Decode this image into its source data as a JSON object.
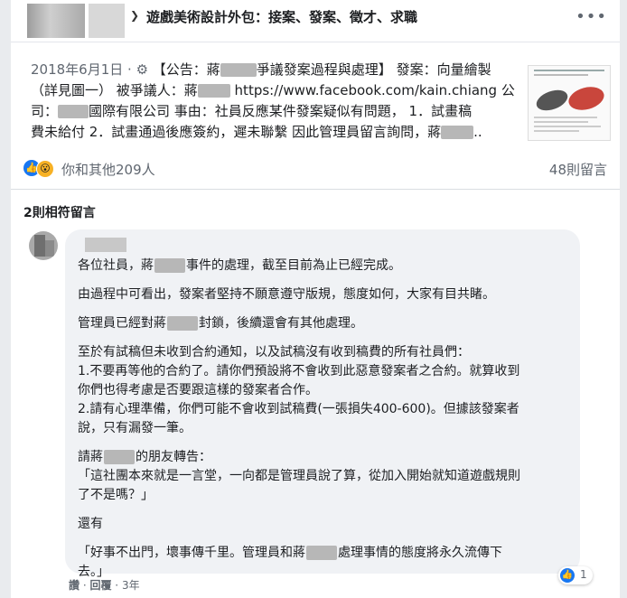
{
  "group": {
    "title": "遊戲美術設計外包：接案、發案、徵才、求職",
    "chevron": "❯",
    "more": "•••"
  },
  "post": {
    "date": "2018年6月1日 · ⚙",
    "line1_a": " 【公告：蔣",
    "line1_b": "爭議發案過程與處理】 發案：向量繪製",
    "line2_a": "（詳見圖一） 被爭議人：蔣",
    "line2_b": " https://www.facebook.com/kain.chiang 公",
    "line3_a": "司：",
    "line3_b": "國際有限公司 事由：社員反應某件發案疑似有問題， 1．試畫稿",
    "line4_a": "費未給付 2．試畫通過後應簽約，遲未聯繫 因此管理員留言詢問，蔣",
    "line4_b": ".."
  },
  "reactions": {
    "like_icon": "👍",
    "wow_icon": "😮",
    "text": "你和其他209人",
    "comments": "48則留言"
  },
  "matching_label": "2則相符留言",
  "comment": {
    "p1_a": "各位社員，蔣",
    "p1_b": "事件的處理，截至目前為止已經完成。",
    "p2": "由過程中可看出，發案者堅持不願意遵守版規，態度如何，大家有目共睹。",
    "p3_a": "管理員已經對蔣",
    "p3_b": "封鎖，後續還會有其他處理。",
    "p4_l1": "至於有試稿但未收到合約通知，以及試稿沒有收到稿費的所有社員們：",
    "p4_l2": "1.不要再等他的合約了。請你們預設將不會收到此惡意發案者之合約。就算收到",
    "p4_l3": "你們也得考慮是否要跟這樣的發案者合作。",
    "p4_l4": "2.請有心理準備，你們可能不會收到試稿費(一張損失400-600)。但據該發案者",
    "p4_l5": "說，只有漏發一筆。",
    "p5_a": "請蔣",
    "p5_b": "的朋友轉告：",
    "p5_l2": "「這社團本來就是一言堂，一向都是管理員說了算，從加入開始就知道遊戲規則",
    "p5_l3": "了不是嗎？」",
    "p6": "還有",
    "p7_a": "「好事不出門，壞事傳千里。管理員和蔣",
    "p7_b": "處理事情的態度將永久流傳下",
    "p7_l2": "去。」",
    "like_count": "1",
    "like_label": "讚",
    "sep": " · ",
    "reply_label": "回覆",
    "age": "3年"
  },
  "colors": {
    "like_blue": "#1877f2",
    "wow_yellow": "#f7b125",
    "bubble_bg": "#f0f2f5",
    "page_bg": "#e9ebee"
  }
}
